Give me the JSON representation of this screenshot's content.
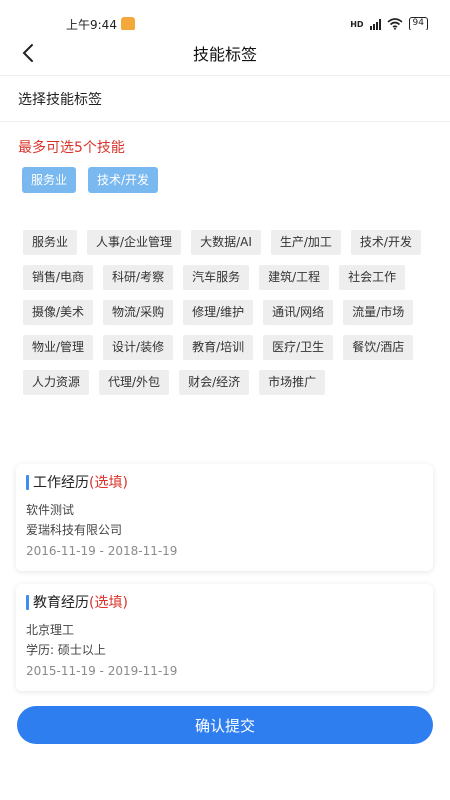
{
  "status_bar": {
    "time": "上午9:44",
    "network": "HD",
    "battery": "94"
  },
  "nav": {
    "back_icon": "chevron-left-icon",
    "title": "技能标签"
  },
  "section": {
    "title": "选择技能标签"
  },
  "limit_text": "最多可选5个技能",
  "selected_skills": [
    "服务业",
    "技术/开发"
  ],
  "skills": [
    "服务业",
    "人事/企业管理",
    "大数据/AI",
    "生产/加工",
    "技术/开发",
    "销售/电商",
    "科研/考察",
    "汽车服务",
    "建筑/工程",
    "社会工作",
    "摄像/美术",
    "物流/采购",
    "修理/维护",
    "通讯/网络",
    "流量/市场",
    "物业/管理",
    "设计/装修",
    "教育/培训",
    "医疗/卫生",
    "餐饮/酒店",
    "人力资源",
    "代理/外包",
    "财会/经济",
    "市场推广"
  ],
  "work_experience": {
    "title": "工作经历",
    "optional_label": "(选填)",
    "position": "软件测试",
    "company": "爱瑞科技有限公司",
    "date_range": "2016-11-19 - 2018-11-19"
  },
  "education_experience": {
    "title": "教育经历",
    "optional_label": "(选填)",
    "school": "北京理工",
    "degree": "学历: 硕士以上",
    "date_range": "2015-11-19 - 2019-11-19"
  },
  "submit_label": "确认提交",
  "colors": {
    "accent": "#2f7ef0",
    "selected_chip": "#7ab8f0",
    "warning_red": "#d9342b",
    "chip_bg": "#eeeeee"
  }
}
